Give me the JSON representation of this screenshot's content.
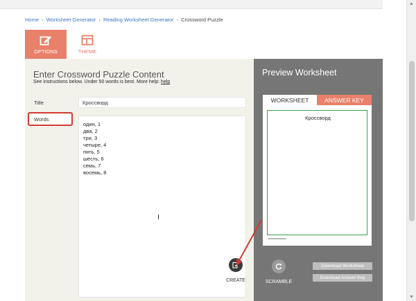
{
  "breadcrumb": {
    "items": [
      "Home",
      "Worksheet Generator",
      "Reading Worksheet Generator",
      "Crossword Puzzle"
    ],
    "separator": "›"
  },
  "tabs": {
    "options": {
      "label": "OPTIONS",
      "icon": "edit-icon"
    },
    "theme": {
      "label": "THEME",
      "icon": "layout-icon"
    }
  },
  "form": {
    "heading": "Enter Crossword Puzzle Content",
    "instructions": "See instructions below. Under 50 words is best. More help:",
    "help_link": "help",
    "title_label": "Title",
    "title_value": "Кроссворд",
    "words_label": "Words",
    "words": [
      "один, 1",
      "два, 2",
      "три, 3",
      "четыре, 4",
      "пять, 5",
      "шесть, 6",
      "семь, 7",
      "восемь, 8"
    ]
  },
  "preview": {
    "heading": "Preview Worksheet",
    "tab_worksheet": "WORKSHEET",
    "tab_answer_key": "ANSWER KEY",
    "sheet_title": "Кроссворд"
  },
  "actions": {
    "create_label": "CREATE",
    "scramble_label": "SCRAMBLE",
    "download_worksheet": "Download Worksheet",
    "download_answer_key": "Download Answer Key"
  },
  "colors": {
    "accent": "#e8806a",
    "preview_bg": "#767676",
    "content_bg": "#f3f2ea",
    "highlight_red": "#d23a32",
    "sheet_border": "#3c9a4c"
  }
}
